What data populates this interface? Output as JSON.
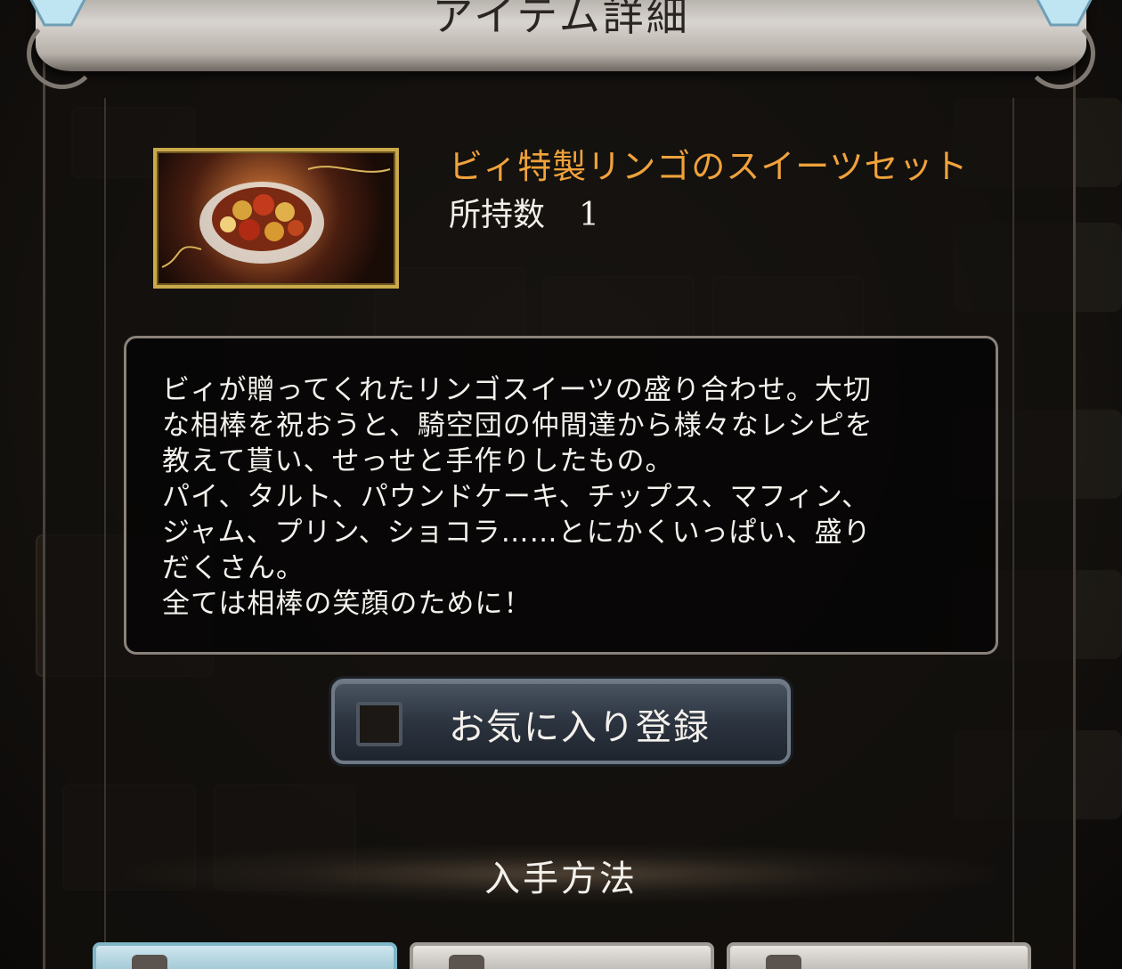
{
  "dialog": {
    "title": "アイテム詳細"
  },
  "item": {
    "name": "ビィ特製リンゴのスイーツセット",
    "count_label": "所持数",
    "count_value": "1",
    "description": "ビィが贈ってくれたリンゴスイーツの盛り合わせ。大切\nな相棒を祝おうと、騎空団の仲間達から様々なレシピを\n教えて貰い、せっせと手作りしたもの。\nパイ、タルト、パウンドケーキ、チップス、マフィン、\nジャム、プリン、ショコラ……とにかくいっぱい、盛り\nだくさん。\n全ては相棒の笑顔のために！"
  },
  "favorite": {
    "label": "お気に入り登録",
    "checked": false
  },
  "acquisition": {
    "title": "入手方法"
  },
  "colors": {
    "item_name": "#f0a23b",
    "frame_gold": "#c9a94a",
    "button_border": "#6f7a86"
  }
}
